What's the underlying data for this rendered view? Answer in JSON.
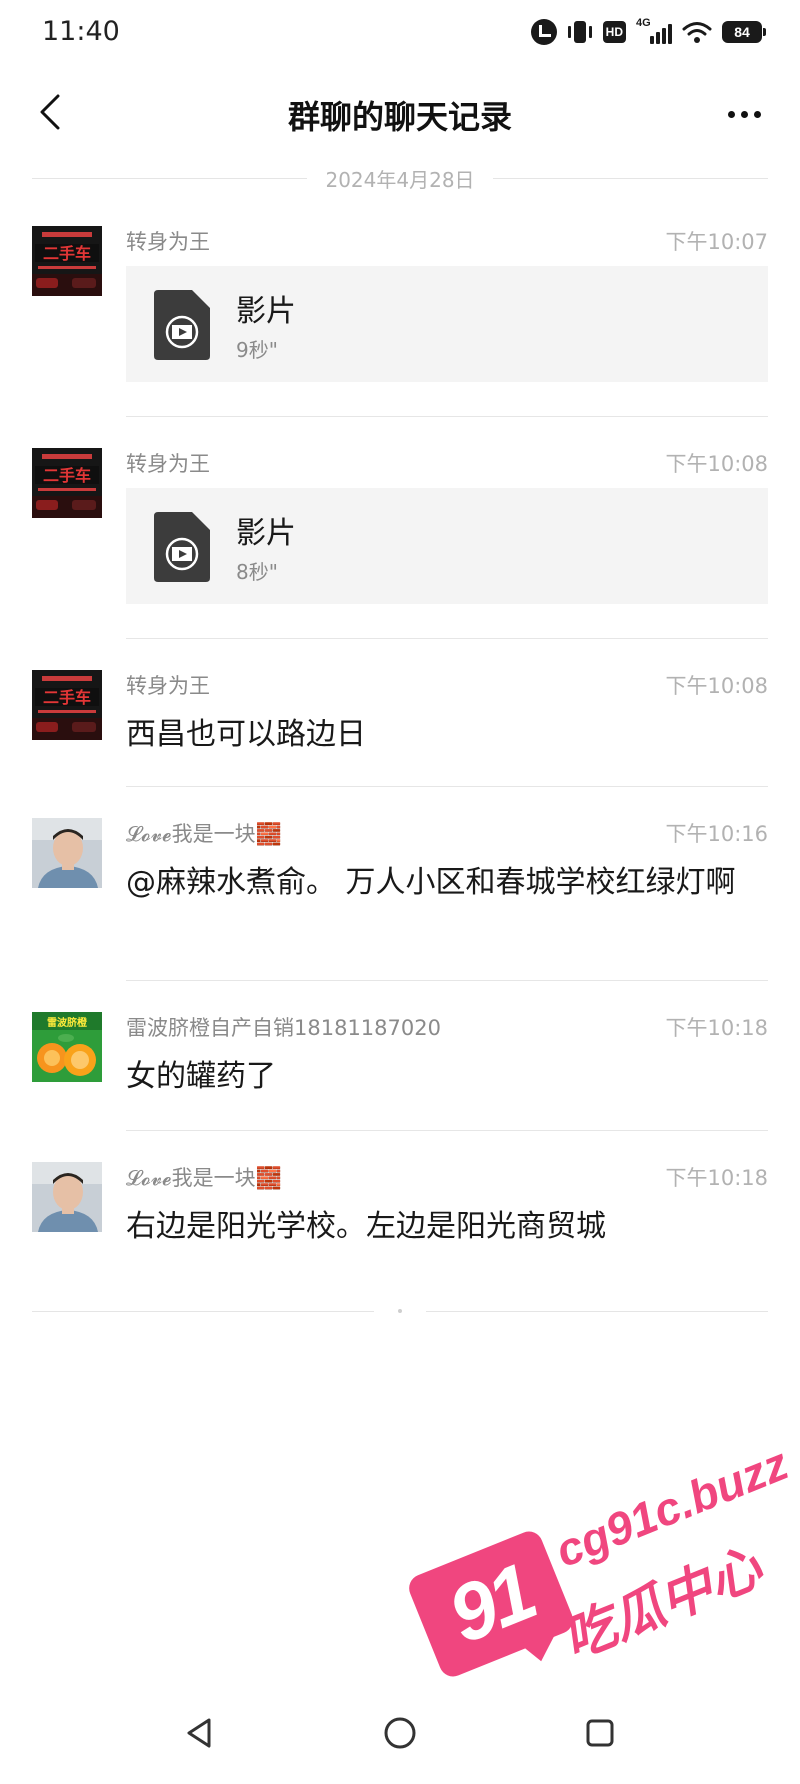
{
  "status_bar": {
    "time": "11:40",
    "network_tag": "4G",
    "hd_label": "HD",
    "battery": "84",
    "icons": [
      "alarm-icon",
      "vibrate-icon",
      "hd-icon",
      "signal-icon",
      "wifi-icon",
      "battery-icon"
    ]
  },
  "nav": {
    "title": "群聊的聊天记录",
    "back_icon": "chevron-left-icon",
    "more_icon": "more-dots-icon"
  },
  "date_divider": "2024年4月28日",
  "messages": [
    {
      "sender": "转身为王",
      "time": "下午10:07",
      "type": "video",
      "video_title": "影片",
      "video_duration": "9秒\""
    },
    {
      "sender": "转身为王",
      "time": "下午10:08",
      "type": "video",
      "video_title": "影片",
      "video_duration": "8秒\""
    },
    {
      "sender": "转身为王",
      "time": "下午10:08",
      "type": "text",
      "text": "西昌也可以路边日"
    },
    {
      "sender": "𝓛𝓸𝓿𝓮我是一块🧱",
      "time": "下午10:16",
      "type": "text",
      "text": "@麻辣水煮俞。 万人小区和春城学校红绿灯啊"
    },
    {
      "sender": "雷波脐橙自产自销18181187020",
      "time": "下午10:18",
      "type": "text",
      "text": "女的罐药了"
    },
    {
      "sender": "𝓛𝓸𝓿𝓮我是一块🧱",
      "time": "下午10:18",
      "type": "text",
      "text": "右边是阳光学校。左边是阳光商贸城"
    }
  ],
  "avatars": {
    "car_text": "二手车",
    "orange_text": "雷波脐橙"
  },
  "watermark": {
    "number": "91",
    "domain": "cg91c.buzz",
    "text": "吃瓜中心"
  },
  "colors": {
    "background": "#ffffff",
    "card": "#f4f4f4",
    "watermark": "#f0467f",
    "secondary_text": "#8a8a8a"
  }
}
